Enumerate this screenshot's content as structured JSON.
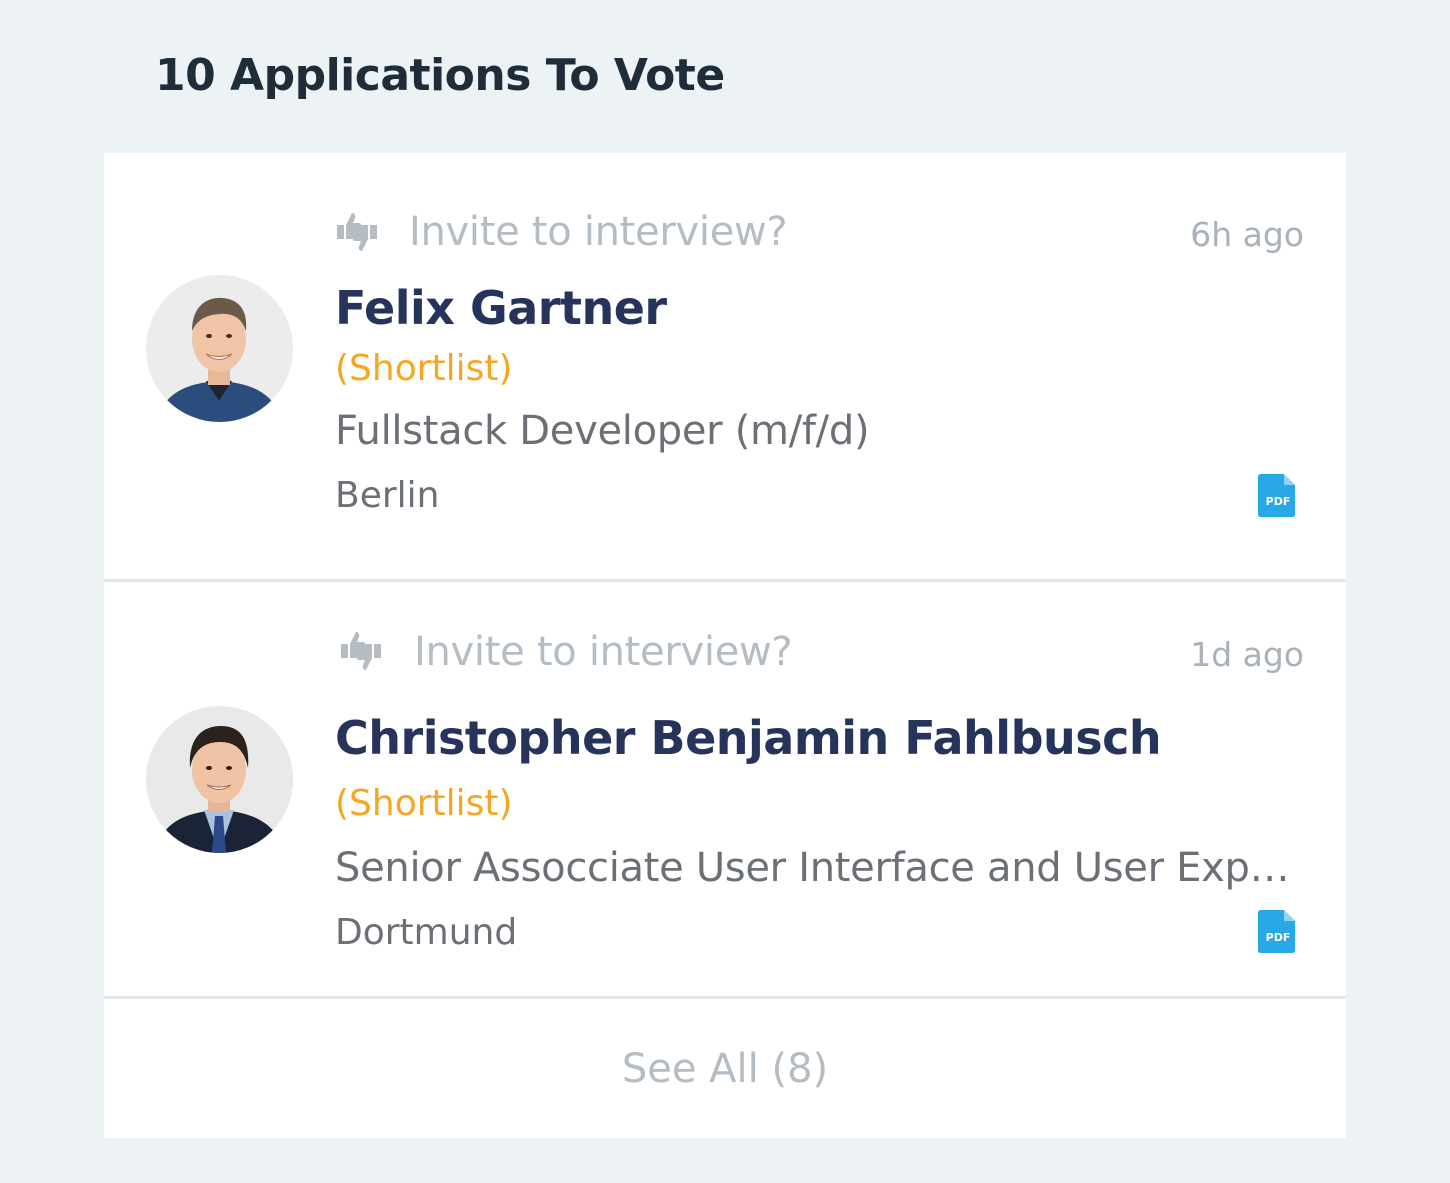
{
  "header": {
    "title": "10 Applications To Vote"
  },
  "applications": [
    {
      "question": "Invite to interview?",
      "time": "6h ago",
      "name": "Felix Gartner",
      "status": "(Shortlist)",
      "position": "Fullstack Developer (m/f/d)",
      "location": "Berlin",
      "attachment_icon": "pdf-file-icon",
      "vote_icon": "thumbs-up-down-icon"
    },
    {
      "question": "Invite to interview?",
      "time": "1d ago",
      "name": "Christopher Benjamin Fahlbusch",
      "status": "(Shortlist)",
      "position": "Senior Assocciate User Interface and User Experience Designer",
      "location": "Dortmund",
      "attachment_icon": "pdf-file-icon",
      "vote_icon": "thumbs-up-down-icon"
    }
  ],
  "footer": {
    "see_all_label": "See All (8)"
  },
  "colors": {
    "background": "#edf2f5",
    "panel": "#ffffff",
    "name": "#26335a",
    "status": "#f5a623",
    "muted": "#b4bcc4",
    "text": "#6b7076",
    "pdf": "#29a8e8"
  }
}
